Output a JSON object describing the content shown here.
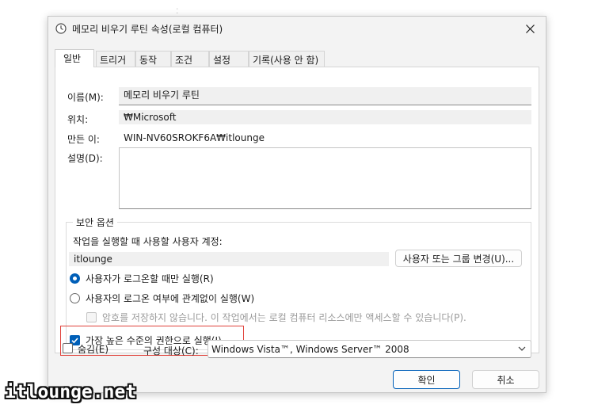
{
  "window": {
    "title": "메모리 비우기 루틴 속성(로컬 컴퓨터)",
    "title_icon": "clock-icon",
    "close_icon": "close-icon"
  },
  "tabs": [
    {
      "label": "일반",
      "active": true
    },
    {
      "label": "트리거"
    },
    {
      "label": "동작"
    },
    {
      "label": "조건"
    },
    {
      "label": "설정"
    },
    {
      "label": "기록(사용 안 함)"
    }
  ],
  "general": {
    "name_label": "이름(M):",
    "name_value": "메모리 비우기 루틴",
    "location_label": "위치:",
    "location_value": "₩Microsoft",
    "author_label": "만든 이:",
    "author_value": "WIN-NV60SROKF6A₩itlounge",
    "description_label": "설명(D):",
    "description_value": ""
  },
  "security": {
    "group_title": "보안 옵션",
    "account_prompt": "작업을 실행할 때 사용할 사용자 계정:",
    "account_value": "itlounge",
    "change_button": "사용자 또는 그룹 변경(U)...",
    "radio_logged_on": "사용자가 로그온할 때만 실행(R)",
    "radio_whether": "사용자의 로그온 여부에 관계없이 실행(W)",
    "no_store_password": "암호를 저장하지 않습니다. 이 작업에서는 로컬 컴퓨터 리소스에만 액세스할 수 있습니다(P).",
    "highest_privileges": "가장 높은 수준의 권한으로 실행(I)",
    "highlight_color": "#e0413a"
  },
  "footer": {
    "hidden_label": "숨김(E)",
    "configure_label": "구성 대상(C):",
    "configure_value": "Windows Vista™, Windows Server™ 2008",
    "ok_button": "확인",
    "cancel_button": "취소"
  },
  "watermark": "itlounge.net",
  "colors": {
    "accent": "#005fb8",
    "window_bg": "#f3f3f3"
  }
}
